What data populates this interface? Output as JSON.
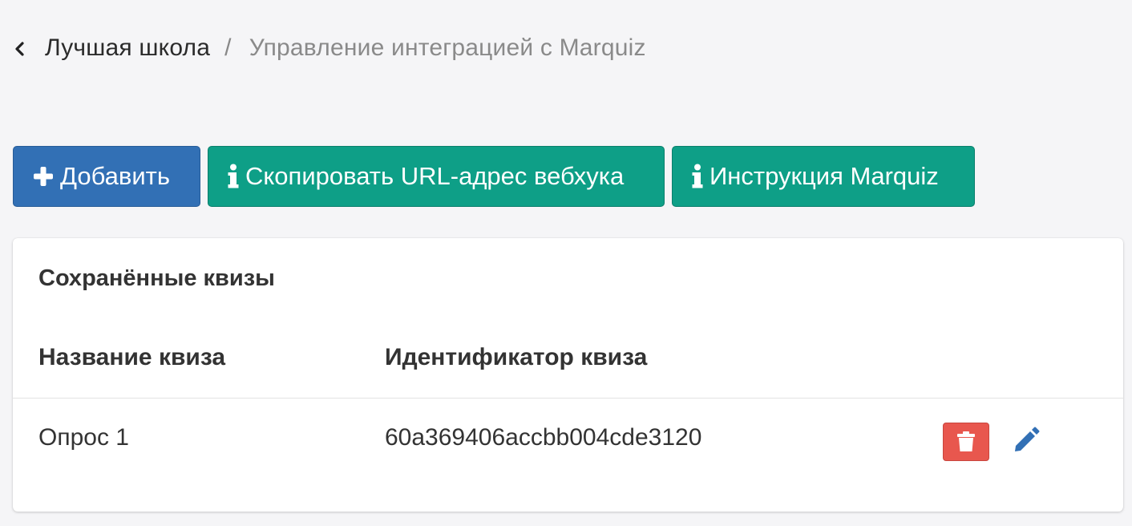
{
  "breadcrumb": {
    "back_icon": "chevron-left-icon",
    "parent": "Лучшая школа",
    "separator": "/",
    "current": "Управление интеграцией с Marquiz"
  },
  "toolbar": {
    "add_label": "Добавить",
    "add_icon": "plus-icon",
    "copy_webhook_label": "Скопировать URL-адрес вебхука",
    "instructions_label": "Инструкция Marquiz",
    "info_icon": "info-icon"
  },
  "colors": {
    "primary": "#3270b5",
    "teal": "#0e9f87",
    "danger": "#e8574e",
    "edit_icon": "#3270b5"
  },
  "card": {
    "title": "Сохранённые квизы",
    "columns": [
      "Название квиза",
      "Идентификатор квиза"
    ],
    "rows": [
      {
        "name": "Опрос 1",
        "id": "60a369406accbb004cde3120"
      }
    ],
    "row_actions": [
      "trash-icon",
      "pencil-icon"
    ]
  }
}
